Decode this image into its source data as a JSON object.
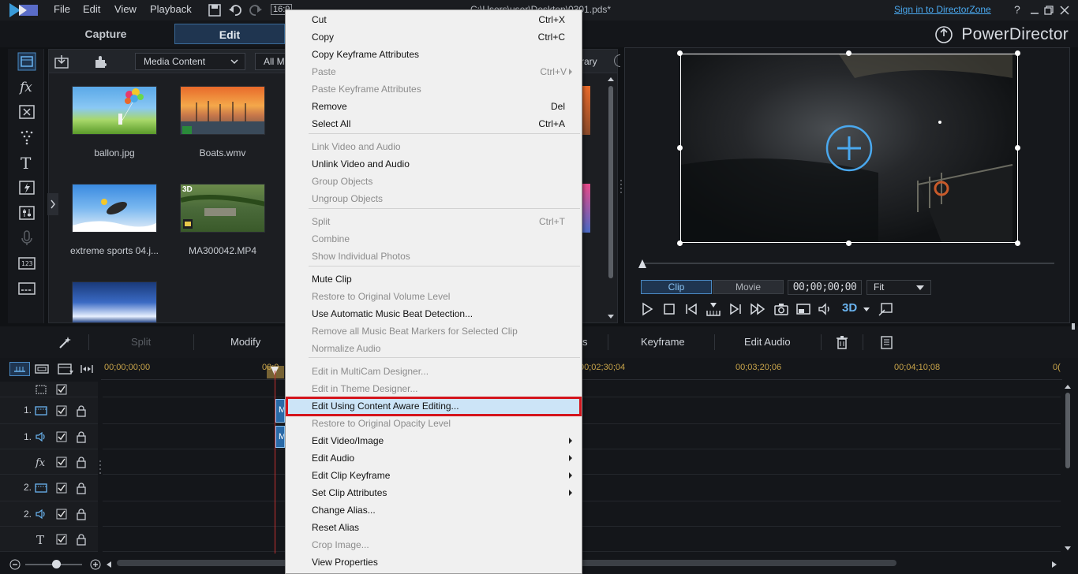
{
  "titlebar": {
    "menu": [
      "File",
      "Edit",
      "View",
      "Playback"
    ],
    "tc_fragment": "16:9",
    "title": "C:\\Users\\user\\Desktop\\0301.pds*",
    "signin": "Sign in to DirectorZone",
    "help": "?"
  },
  "modes": {
    "capture": "Capture",
    "edit": "Edit"
  },
  "brand": "PowerDirector",
  "library": {
    "dropdown_content": "Media Content",
    "dropdown_filter": "All M",
    "right_fragment": "rary",
    "items": [
      {
        "name": "ballon.jpg"
      },
      {
        "name": "Boats.wmv"
      },
      {
        "name": "extreme sports 04.j..."
      },
      {
        "name": "MA300042.MP4"
      }
    ],
    "badge_3d": "3D"
  },
  "preview": {
    "tab_clip": "Clip",
    "tab_movie": "Movie",
    "timecode": "00;00;00;00",
    "fit": "Fit",
    "badge_3d": "3D"
  },
  "edit_toolbar": {
    "split": "Split",
    "modify": "Modify",
    "fragment": "s",
    "keyframe": "Keyframe",
    "edit_audio": "Edit Audio"
  },
  "timeline": {
    "ticks": [
      "00;00;00;00",
      "00;0",
      "00;02;30;04",
      "00;03;20;06",
      "00;04;10;08",
      "0("
    ],
    "tracks": [
      {
        "num": ""
      },
      {
        "num": "1."
      },
      {
        "num": "1."
      },
      {
        "num": ""
      },
      {
        "num": "2."
      },
      {
        "num": "2."
      },
      {
        "num": ""
      }
    ],
    "clip_label": "M"
  },
  "context_menu": {
    "items": [
      {
        "label": "Cut",
        "shortcut": "Ctrl+X",
        "disabled": false
      },
      {
        "label": "Copy",
        "shortcut": "Ctrl+C",
        "disabled": false
      },
      {
        "label": "Copy Keyframe Attributes",
        "shortcut": "",
        "disabled": false
      },
      {
        "label": "Paste",
        "shortcut": "Ctrl+V",
        "disabled": true
      },
      {
        "label": "Paste Keyframe Attributes",
        "shortcut": "",
        "disabled": true
      },
      {
        "label": "Remove",
        "shortcut": "Del",
        "disabled": false
      },
      {
        "label": "Select All",
        "shortcut": "Ctrl+A",
        "disabled": false
      },
      {
        "label": "Link Video and Audio",
        "shortcut": "",
        "disabled": true
      },
      {
        "label": "Unlink Video and Audio",
        "shortcut": "",
        "disabled": false
      },
      {
        "label": "Group Objects",
        "shortcut": "",
        "disabled": true
      },
      {
        "label": "Ungroup Objects",
        "shortcut": "",
        "disabled": true
      },
      {
        "label": "Split",
        "shortcut": "Ctrl+T",
        "disabled": true
      },
      {
        "label": "Combine",
        "shortcut": "",
        "disabled": true
      },
      {
        "label": "Show Individual Photos",
        "shortcut": "",
        "disabled": true
      },
      {
        "label": "Mute Clip",
        "shortcut": "",
        "disabled": false
      },
      {
        "label": "Restore to Original Volume Level",
        "shortcut": "",
        "disabled": true
      },
      {
        "label": "Use Automatic Music Beat Detection...",
        "shortcut": "",
        "disabled": false
      },
      {
        "label": "Remove all Music Beat Markers for Selected Clip",
        "shortcut": "",
        "disabled": true
      },
      {
        "label": "Normalize Audio",
        "shortcut": "",
        "disabled": true
      },
      {
        "label": "Edit in MultiCam Designer...",
        "shortcut": "",
        "disabled": true
      },
      {
        "label": "Edit in Theme Designer...",
        "shortcut": "",
        "disabled": true
      },
      {
        "label": "Edit Using Content Aware Editing...",
        "shortcut": "",
        "disabled": false
      },
      {
        "label": "Restore to Original Opacity Level",
        "shortcut": "",
        "disabled": true
      },
      {
        "label": "Edit Video/Image",
        "shortcut": "",
        "disabled": false
      },
      {
        "label": "Edit Audio",
        "shortcut": "",
        "disabled": false
      },
      {
        "label": "Edit Clip Keyframe",
        "shortcut": "",
        "disabled": false
      },
      {
        "label": "Set Clip Attributes",
        "shortcut": "",
        "disabled": false
      },
      {
        "label": "Change Alias...",
        "shortcut": "",
        "disabled": false
      },
      {
        "label": "Reset Alias",
        "shortcut": "",
        "disabled": false
      },
      {
        "label": "Crop Image...",
        "shortcut": "",
        "disabled": true
      },
      {
        "label": "View Properties",
        "shortcut": "",
        "disabled": false
      }
    ]
  },
  "colors": {
    "accent": "#4aa8ee",
    "highlight_box": "#d4141c",
    "playhead": "#c43030"
  }
}
